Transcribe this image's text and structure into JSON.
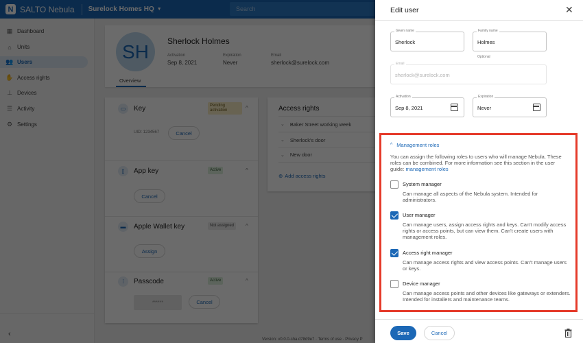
{
  "topbar": {
    "logo_letter": "N",
    "brand": "SALTO Nebula",
    "site": "Surelock Homes HQ",
    "search_placeholder": "Search"
  },
  "sidebar": {
    "items": [
      {
        "label": "Dashboard",
        "icon": "dashboard-icon"
      },
      {
        "label": "Units",
        "icon": "units-icon"
      },
      {
        "label": "Users",
        "icon": "users-icon",
        "active": true
      },
      {
        "label": "Access rights",
        "icon": "hand-icon"
      },
      {
        "label": "Devices",
        "icon": "devices-icon"
      },
      {
        "label": "Activity",
        "icon": "list-icon"
      },
      {
        "label": "Settings",
        "icon": "gear-icon"
      }
    ]
  },
  "profile": {
    "initials": "SH",
    "name": "Sherlock Holmes",
    "activation_label": "Activation",
    "activation_value": "Sep 8, 2021",
    "expiration_label": "Expiration",
    "expiration_value": "Never",
    "email_label": "Email",
    "email_value": "sherlock@surelock.com",
    "tab": "Overview"
  },
  "keys": {
    "key": {
      "title": "Key",
      "status": "Pending activation",
      "uid": "UID: 1234567",
      "action": "Cancel"
    },
    "app_key": {
      "title": "App key",
      "status": "Active",
      "action": "Cancel"
    },
    "wallet": {
      "title": "Apple Wallet key",
      "status": "Not assigned",
      "action": "Assign"
    },
    "passcode": {
      "title": "Passcode",
      "status": "Active",
      "masked": "******",
      "action": "Cancel"
    }
  },
  "access_rights": {
    "title": "Access rights",
    "items": [
      "Baker Street working week",
      "Sherlock's door",
      "New door"
    ],
    "add_label": "Add access rights"
  },
  "footer": {
    "text": "Version: v0.0.0-sha.d78d9e7 · Terms of use · Privacy P"
  },
  "drawer": {
    "title": "Edit user",
    "given_name_label": "Given name",
    "given_name_value": "Sherlock",
    "family_name_label": "Family name",
    "family_name_value": "Holmes",
    "family_name_helper": "Optional",
    "email_label": "Email",
    "email_value": "sherlock@surelock.com",
    "activation_label": "Activation",
    "activation_value": "Sep 8, 2021",
    "expiration_label": "Expiration",
    "expiration_value": "Never",
    "roles": {
      "header": "Management roles",
      "intro": "You can assign the following roles to users who will manage Nebula. These roles can be combined. For more information see this section in the user guide: ",
      "intro_link": "management roles",
      "items": [
        {
          "name": "System manager",
          "checked": false,
          "desc": "Can manage all aspects of the Nebula system. Intended for administrators."
        },
        {
          "name": "User manager",
          "checked": true,
          "desc": "Can manage users, assign access rights and keys. Can't modify access rights or access points, but can view them. Can't create users with management roles."
        },
        {
          "name": "Access right manager",
          "checked": true,
          "desc": "Can manage access rights and view access points. Can't manage users or keys."
        },
        {
          "name": "Device manager",
          "checked": false,
          "desc": "Can manage access points and other devices like gateways or extenders. Intended for installers and maintenance teams."
        }
      ]
    },
    "save_label": "Save",
    "cancel_label": "Cancel"
  },
  "colors": {
    "brand": "#1c68b6",
    "highlight": "#e53a2a"
  }
}
